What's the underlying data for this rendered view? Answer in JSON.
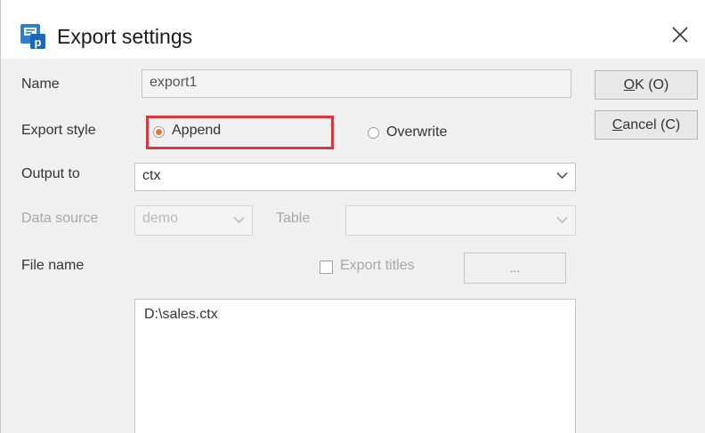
{
  "window": {
    "title": "Export settings",
    "icon": "export-app-icon",
    "close_icon": "close-icon"
  },
  "buttons": {
    "ok": {
      "mnemonic": "O",
      "rest": "K (O)"
    },
    "cancel": {
      "mnemonic": "C",
      "rest": "ancel (C)"
    }
  },
  "form": {
    "name": {
      "label": "Name",
      "value": "export1"
    },
    "export_style": {
      "label": "Export style",
      "options": [
        {
          "label": "Append",
          "selected": true
        },
        {
          "label": "Overwrite",
          "selected": false
        }
      ]
    },
    "output_to": {
      "label": "Output to",
      "value": "ctx"
    },
    "data_source": {
      "label": "Data source",
      "value": "demo",
      "enabled": false
    },
    "table": {
      "label": "Table",
      "value": "",
      "enabled": false
    },
    "file_name": {
      "label": "File name",
      "export_titles_label": "Export titles",
      "export_titles_checked": false,
      "browse_label": "...",
      "value": "D:\\sales.ctx"
    }
  },
  "colors": {
    "highlight_border": "#d9363e",
    "radio_selected": "#e07a3c",
    "icon_blue": "#2f7fd6"
  }
}
